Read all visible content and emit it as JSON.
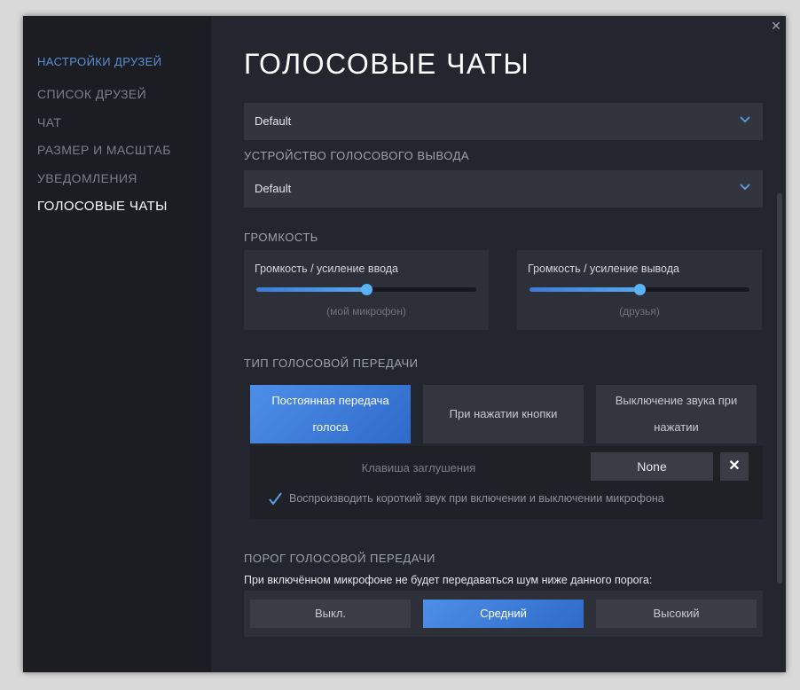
{
  "sidebar": {
    "header": "Настройки друзей",
    "items": [
      "Список друзей",
      "Чат",
      "Размер и масштаб",
      "Уведомления"
    ],
    "active": "Голосовые чаты"
  },
  "page": {
    "title": "ГОЛОСОВЫЕ ЧАТЫ"
  },
  "input_device": {
    "value": "Default"
  },
  "output_device": {
    "label": "Устройство голосового вывода",
    "value": "Default"
  },
  "volume": {
    "label": "Громкость",
    "input": {
      "title": "Громкость / усиление ввода",
      "subtitle": "(мой микрофон)",
      "level": 0.5
    },
    "output": {
      "title": "Громкость / усиление вывода",
      "subtitle": "(друзья)",
      "level": 0.5
    }
  },
  "transmission": {
    "label": "Тип голосовой передачи",
    "options": [
      "Постоянная передача голоса",
      "При нажатии кнопки",
      "Выключение звука при нажатии"
    ],
    "selected": 0,
    "mute_key_label": "Клавиша заглушения",
    "mute_key_value": "None",
    "clear_symbol": "✕",
    "sound_checkbox_label": "Воспроизводить короткий звук при включении и выключении микрофона",
    "sound_checkbox_checked": true
  },
  "threshold": {
    "label": "Порог голосовой передачи",
    "hint": "При включённом микрофоне не будет передаваться шум ниже данного порога:",
    "options": [
      "Выкл.",
      "Средний",
      "Высокий"
    ],
    "selected": 1
  },
  "colors": {
    "accent": "#3d7ad6",
    "background": "#23262e",
    "sidebar": "#1b1d23"
  },
  "icons": {
    "close": "close-icon",
    "dropdown": "chevron-down-icon",
    "check": "checkmark-icon"
  }
}
